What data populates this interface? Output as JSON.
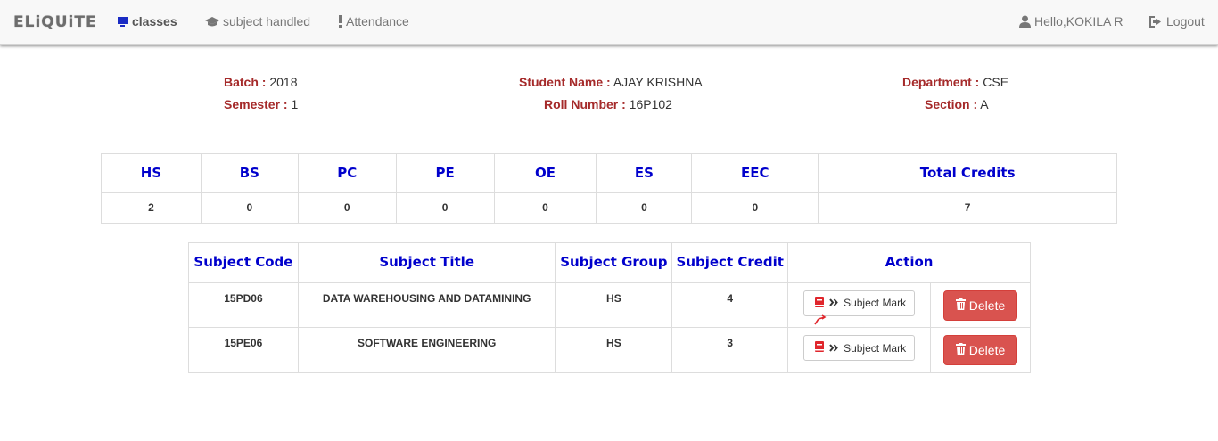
{
  "navbar": {
    "brand": "ELiQUiTE",
    "items": [
      {
        "label": "classes",
        "icon": "desktop-icon"
      },
      {
        "label": "subject handled",
        "icon": "graduation-cap-icon"
      },
      {
        "label": "Attendance",
        "icon": "exclamation-icon"
      }
    ],
    "user_greeting": "Hello,KOKILA R",
    "logout_label": "Logout"
  },
  "student": {
    "batch_label": "Batch :",
    "batch": "2018",
    "semester_label": "Semester :",
    "semester": "1",
    "name_label": "Student Name :",
    "name": "AJAY KRISHNA",
    "roll_label": "Roll Number :",
    "roll": "16P102",
    "department_label": "Department :",
    "department": "CSE",
    "section_label": "Section :",
    "section": "A"
  },
  "credits_table": {
    "headers": [
      "HS",
      "BS",
      "PC",
      "PE",
      "OE",
      "ES",
      "EEC",
      "Total Credits"
    ],
    "values": [
      "2",
      "0",
      "0",
      "0",
      "0",
      "0",
      "0",
      "7"
    ]
  },
  "subjects_table": {
    "headers": [
      "Subject Code",
      "Subject Title",
      "Subject Group",
      "Subject Credit",
      "Action"
    ],
    "rows": [
      {
        "code": "15PD06",
        "title": "DATA WAREHOUSING AND DATAMINING",
        "group": "HS",
        "credit": "4",
        "mark_label": "Subject Mark",
        "delete_label": "Delete"
      },
      {
        "code": "15PE06",
        "title": "SOFTWARE ENGINEERING",
        "group": "HS",
        "credit": "3",
        "mark_label": "Subject Mark",
        "delete_label": "Delete"
      }
    ]
  },
  "colors": {
    "label_red": "#a52a2a",
    "header_blue": "#0000cc",
    "danger": "#d9534f",
    "book_icon": "#e0262c"
  }
}
